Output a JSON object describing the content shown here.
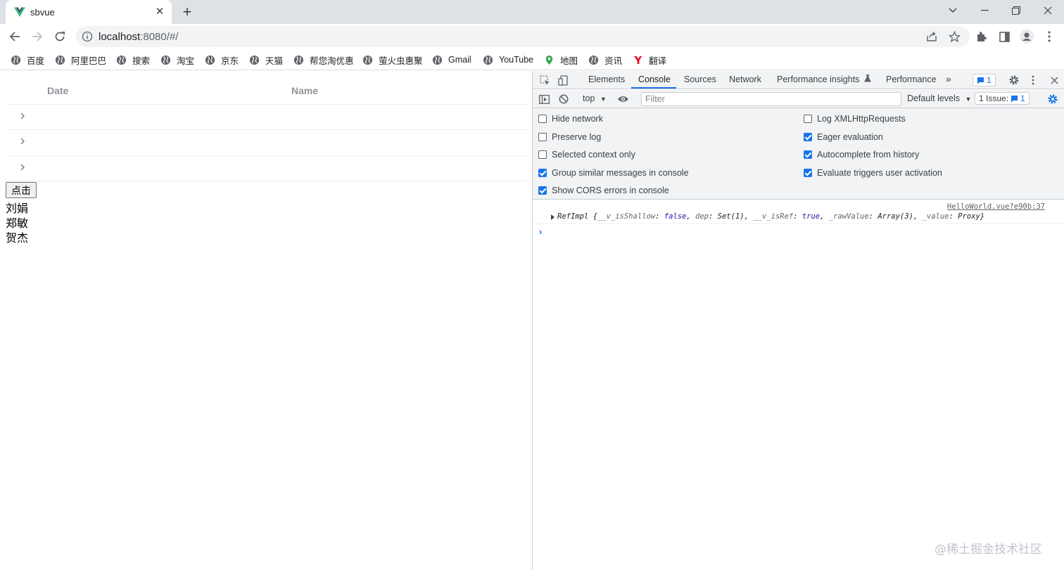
{
  "browser": {
    "tab_title": "sbvue",
    "url_host": "localhost",
    "url_rest": ":8080/#/"
  },
  "bookmarks": [
    "百度",
    "阿里巴巴",
    "搜索",
    "淘宝",
    "京东",
    "天猫",
    "帮您淘优惠",
    "萤火虫惠聚",
    "Gmail",
    "YouTube",
    "地图",
    "资讯",
    "翻译"
  ],
  "page": {
    "table_headers": {
      "date": "Date",
      "name": "Name"
    },
    "click_button": "点击",
    "names": [
      "刘娟",
      "郑敏",
      "贺杰"
    ]
  },
  "devtools": {
    "tabs": [
      "Elements",
      "Console",
      "Sources",
      "Network",
      "Performance insights",
      "Performance"
    ],
    "active_tab": "Console",
    "message_badge": "1",
    "context": "top",
    "filter_placeholder": "Filter",
    "levels": "Default levels",
    "issues_label": "1 Issue:",
    "issues_count": "1",
    "settings_left": [
      {
        "label": "Hide network",
        "checked": false
      },
      {
        "label": "Preserve log",
        "checked": false
      },
      {
        "label": "Selected context only",
        "checked": false
      },
      {
        "label": "Group similar messages in console",
        "checked": true
      },
      {
        "label": "Show CORS errors in console",
        "checked": true
      }
    ],
    "settings_right": [
      {
        "label": "Log XMLHttpRequests",
        "checked": false
      },
      {
        "label": "Eager evaluation",
        "checked": true
      },
      {
        "label": "Autocomplete from history",
        "checked": true
      },
      {
        "label": "Evaluate triggers user activation",
        "checked": true
      }
    ],
    "log_source": "HelloWorld.vue?e90b:37",
    "log": {
      "cls": "RefImpl",
      "k1": "__v_isShallow",
      "v1": "false",
      "k2": "dep",
      "v2": "Set(1)",
      "k3": "__v_isRef",
      "v3": "true",
      "k4": "_rawValue",
      "v4": "Array(3)",
      "k5": "_value",
      "v5": "Proxy"
    }
  },
  "watermark": "@稀土掘金技术社区"
}
